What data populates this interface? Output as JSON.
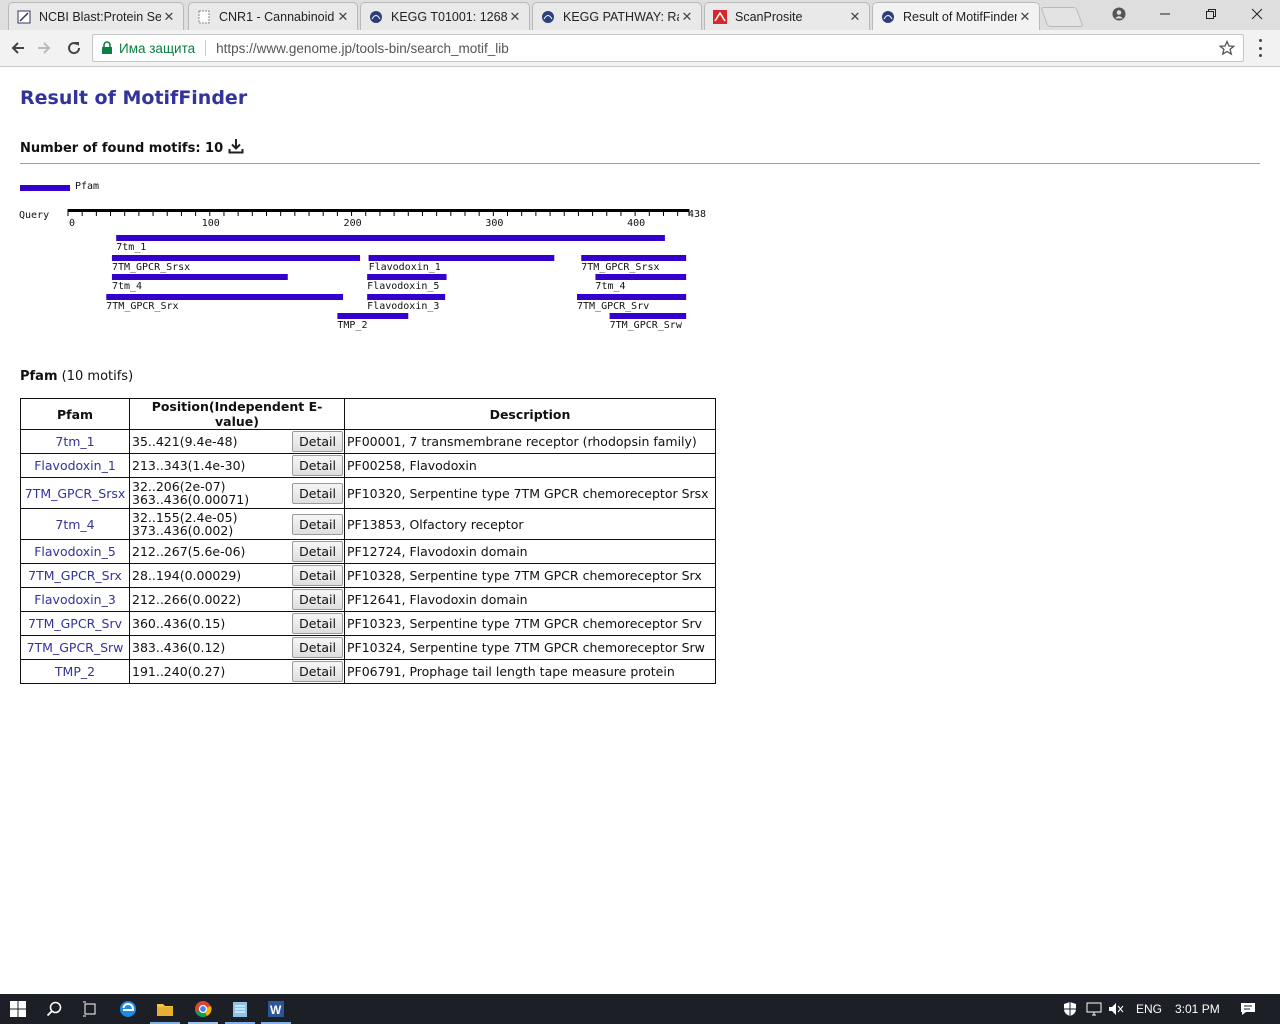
{
  "browser": {
    "tabs": [
      {
        "title": "NCBI Blast:Protein Se",
        "icon": "ncbi-icon",
        "active": false
      },
      {
        "title": "CNR1 - Cannabinoid",
        "icon": "page-icon",
        "active": false
      },
      {
        "title": "KEGG T01001: 1268",
        "icon": "kegg-icon",
        "active": false
      },
      {
        "title": "KEGG PATHWAY: Rap",
        "icon": "kegg-icon",
        "active": false
      },
      {
        "title": "ScanProsite",
        "icon": "expasy-icon",
        "active": false
      },
      {
        "title": "Result of MotifFinder",
        "icon": "kegg-icon",
        "active": true
      }
    ],
    "secure_label": "Има защита",
    "url": "https://www.genome.jp/tools-bin/search_motif_lib"
  },
  "page": {
    "title": "Result of MotifFinder",
    "found_label": "Number of found motifs: 10",
    "legend": {
      "label": "Pfam",
      "color": "#3300cc"
    },
    "section": {
      "name": "Pfam",
      "count": "(10 motifs)"
    }
  },
  "motif_map": {
    "query_label": "Query",
    "length": 438,
    "ticks": [
      0,
      100,
      200,
      300,
      400
    ],
    "end_label": "438",
    "bar_color": "#3300cc",
    "hits": [
      {
        "name": "7tm_1",
        "ranges": [
          [
            35,
            421
          ]
        ]
      },
      {
        "name": "7TM_GPCR_Srsx",
        "ranges": [
          [
            32,
            206
          ],
          [
            363,
            436
          ]
        ]
      },
      {
        "name": "Flavodoxin_1",
        "ranges": [
          [
            213,
            343
          ]
        ]
      },
      {
        "name": "7tm_4",
        "ranges": [
          [
            32,
            155
          ],
          [
            373,
            436
          ]
        ]
      },
      {
        "name": "Flavodoxin_5",
        "ranges": [
          [
            212,
            267
          ]
        ]
      },
      {
        "name": "7TM_GPCR_Srx",
        "ranges": [
          [
            28,
            194
          ]
        ]
      },
      {
        "name": "Flavodoxin_3",
        "ranges": [
          [
            212,
            266
          ]
        ]
      },
      {
        "name": "7TM_GPCR_Srv",
        "ranges": [
          [
            360,
            436
          ]
        ]
      },
      {
        "name": "TMP_2",
        "ranges": [
          [
            191,
            240
          ]
        ]
      },
      {
        "name": "7TM_GPCR_Srw",
        "ranges": [
          [
            383,
            436
          ]
        ]
      }
    ]
  },
  "table": {
    "headers": [
      "Pfam",
      "Position(Independent E-value)",
      "Description"
    ],
    "detail_label": "Detail",
    "rows": [
      {
        "pfam": "7tm_1",
        "pos1": "35..421(9.4e-48)",
        "pos2": "",
        "desc": "PF00001, 7 transmembrane receptor (rhodopsin family)"
      },
      {
        "pfam": "Flavodoxin_1",
        "pos1": "213..343(1.4e-30)",
        "pos2": "",
        "desc": "PF00258, Flavodoxin"
      },
      {
        "pfam": "7TM_GPCR_Srsx",
        "pos1": "32..206(2e-07)",
        "pos2": "363..436(0.00071)",
        "desc": "PF10320, Serpentine type 7TM GPCR chemoreceptor Srsx"
      },
      {
        "pfam": "7tm_4",
        "pos1": "32..155(2.4e-05)",
        "pos2": "373..436(0.002)",
        "desc": "PF13853, Olfactory receptor"
      },
      {
        "pfam": "Flavodoxin_5",
        "pos1": "212..267(5.6e-06)",
        "pos2": "",
        "desc": "PF12724, Flavodoxin domain"
      },
      {
        "pfam": "7TM_GPCR_Srx",
        "pos1": "28..194(0.00029)",
        "pos2": "",
        "desc": "PF10328, Serpentine type 7TM GPCR chemoreceptor Srx"
      },
      {
        "pfam": "Flavodoxin_3",
        "pos1": "212..266(0.0022)",
        "pos2": "",
        "desc": "PF12641, Flavodoxin domain"
      },
      {
        "pfam": "7TM_GPCR_Srv",
        "pos1": "360..436(0.15)",
        "pos2": "",
        "desc": "PF10323, Serpentine type 7TM GPCR chemoreceptor Srv"
      },
      {
        "pfam": "7TM_GPCR_Srw",
        "pos1": "383..436(0.12)",
        "pos2": "",
        "desc": "PF10324, Serpentine type 7TM GPCR chemoreceptor Srw"
      },
      {
        "pfam": "TMP_2",
        "pos1": "191..240(0.27)",
        "pos2": "",
        "desc": "PF06791, Prophage tail length tape measure protein"
      }
    ]
  },
  "taskbar": {
    "lang": "ENG",
    "time": "3:01 PM"
  }
}
